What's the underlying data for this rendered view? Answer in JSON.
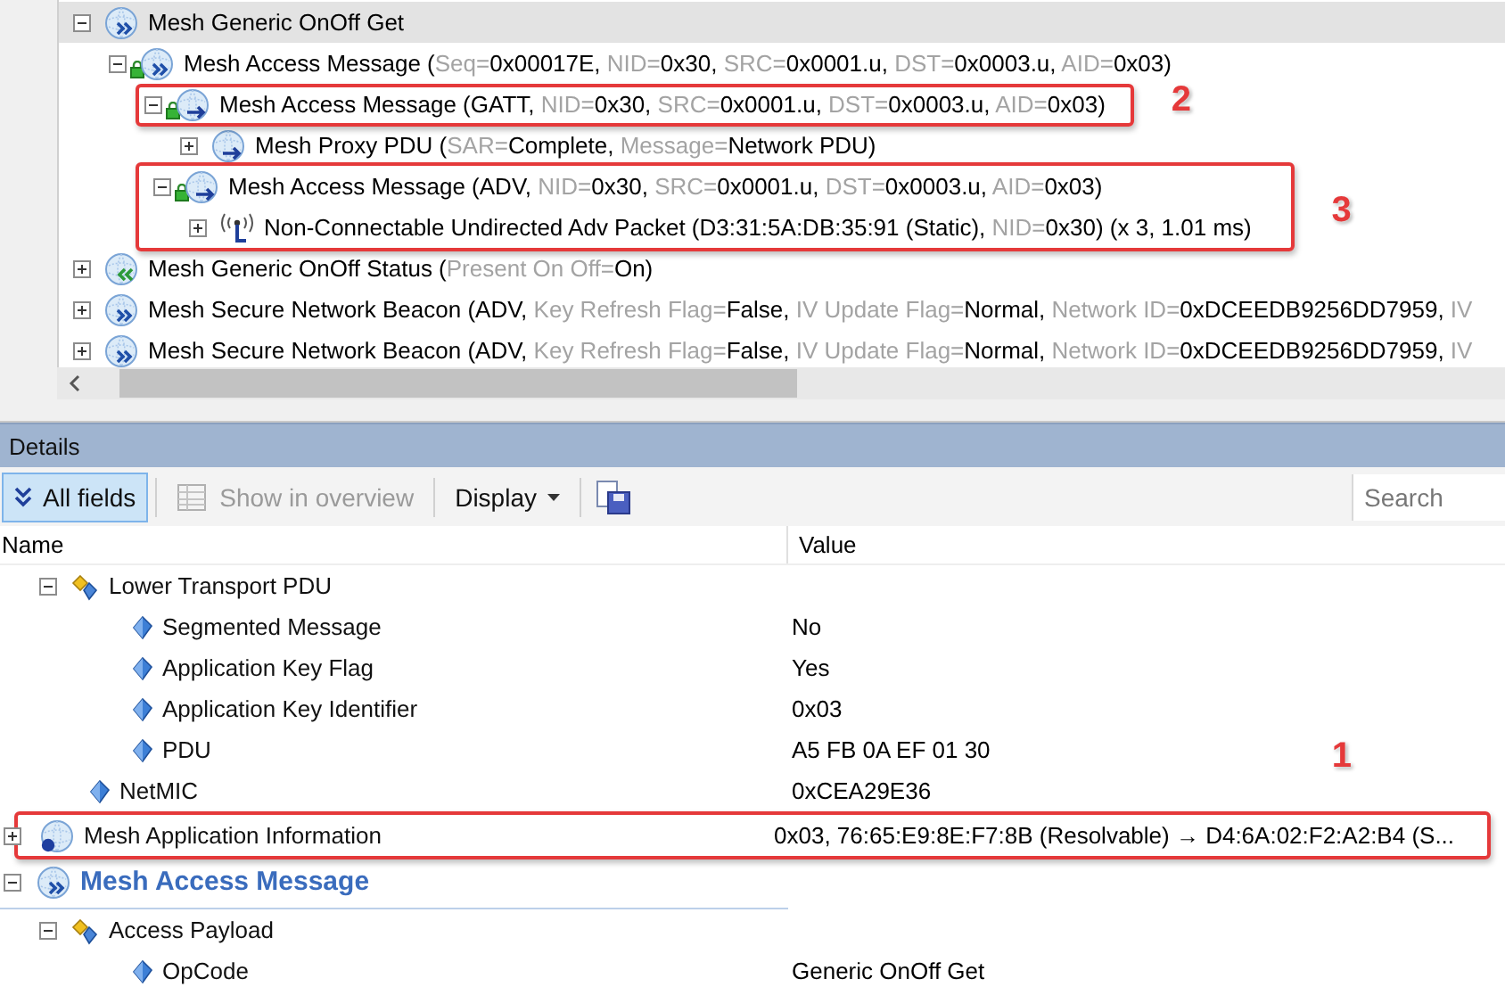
{
  "tree": [
    {
      "kind": "outbound",
      "locked": false,
      "expanded": true,
      "selected": true,
      "parts": [
        {
          "text": "Mesh Generic OnOff Get"
        }
      ],
      "children": [
        {
          "kind": "outbound",
          "locked": true,
          "expanded": true,
          "selected": false,
          "parts": [
            {
              "text": "Mesh Access Message ("
            },
            {
              "text": "Seq=",
              "muted": true
            },
            {
              "text": "0x00017E, "
            },
            {
              "text": "NID=",
              "muted": true
            },
            {
              "text": "0x30, "
            },
            {
              "text": "SRC=",
              "muted": true
            },
            {
              "text": "0x0001.u, "
            },
            {
              "text": "DST=",
              "muted": true
            },
            {
              "text": "0x0003.u, "
            },
            {
              "text": "AID=",
              "muted": true
            },
            {
              "text": "0x03)"
            }
          ],
          "children": [
            {
              "kind": "relay",
              "locked": true,
              "expanded": true,
              "selected": false,
              "callout": "2",
              "parts": [
                {
                  "text": "Mesh Access Message (GATT, "
                },
                {
                  "text": "NID=",
                  "muted": true
                },
                {
                  "text": "0x30, "
                },
                {
                  "text": "SRC=",
                  "muted": true
                },
                {
                  "text": "0x0001.u, "
                },
                {
                  "text": "DST=",
                  "muted": true
                },
                {
                  "text": "0x0003.u, "
                },
                {
                  "text": "AID=",
                  "muted": true
                },
                {
                  "text": "0x03)"
                }
              ],
              "children": [
                {
                  "kind": "relay",
                  "locked": false,
                  "expanded": false,
                  "selected": false,
                  "parts": [
                    {
                      "text": "Mesh Proxy PDU ("
                    },
                    {
                      "text": "SAR=",
                      "muted": true
                    },
                    {
                      "text": "Complete, "
                    },
                    {
                      "text": "Message=",
                      "muted": true
                    },
                    {
                      "text": "Network PDU)"
                    }
                  ]
                }
              ]
            },
            {
              "kind": "annotation",
              "callout": "3",
              "children": [
                {
                  "kind": "relay",
                  "locked": true,
                  "expanded": true,
                  "selected": false,
                  "parts": [
                    {
                      "text": "Mesh Access Message (ADV, "
                    },
                    {
                      "text": "NID=",
                      "muted": true
                    },
                    {
                      "text": "0x30, "
                    },
                    {
                      "text": "SRC=",
                      "muted": true
                    },
                    {
                      "text": "0x0001.u, "
                    },
                    {
                      "text": "DST=",
                      "muted": true
                    },
                    {
                      "text": "0x0003.u, "
                    },
                    {
                      "text": "AID=",
                      "muted": true
                    },
                    {
                      "text": "0x03)"
                    }
                  ],
                  "children": [
                    {
                      "kind": "radio",
                      "locked": false,
                      "expanded": false,
                      "selected": false,
                      "parts": [
                        {
                          "text": "Non-Connectable Undirected Adv Packet (D3:31:5A:DB:35:91 (Static), "
                        },
                        {
                          "text": "NID=",
                          "muted": true
                        },
                        {
                          "text": "0x30) (x 3, 1.01 ms)"
                        }
                      ]
                    }
                  ]
                }
              ]
            }
          ]
        }
      ]
    },
    {
      "kind": "inbound",
      "locked": false,
      "expanded": false,
      "selected": false,
      "parts": [
        {
          "text": "Mesh Generic OnOff Status ("
        },
        {
          "text": "Present On Off=",
          "muted": true
        },
        {
          "text": "On)"
        }
      ]
    },
    {
      "kind": "outbound",
      "locked": false,
      "expanded": false,
      "selected": false,
      "parts": [
        {
          "text": "Mesh Secure Network Beacon (ADV, "
        },
        {
          "text": "Key Refresh Flag=",
          "muted": true
        },
        {
          "text": "False, "
        },
        {
          "text": "IV Update Flag=",
          "muted": true
        },
        {
          "text": "Normal, "
        },
        {
          "text": "Network ID=",
          "muted": true
        },
        {
          "text": "0xDCEEDB9256DD7959, "
        },
        {
          "text": "IV",
          "muted": true
        }
      ]
    },
    {
      "kind": "outbound",
      "locked": false,
      "expanded": false,
      "selected": false,
      "parts": [
        {
          "text": "Mesh Secure Network Beacon (ADV, "
        },
        {
          "text": "Key Refresh Flag=",
          "muted": true
        },
        {
          "text": "False, "
        },
        {
          "text": "IV Update Flag=",
          "muted": true
        },
        {
          "text": "Normal, "
        },
        {
          "text": "Network ID=",
          "muted": true
        },
        {
          "text": "0xDCEEDB9256DD7959, "
        },
        {
          "text": "IV",
          "muted": true
        }
      ]
    }
  ],
  "details": {
    "title": "Details",
    "toolbar": [
      {
        "kind": "toggle",
        "label": "All fields",
        "pressed": true,
        "disabled": false
      },
      {
        "kind": "action",
        "label": "Show in overview",
        "pressed": false,
        "disabled": true
      },
      {
        "kind": "menu",
        "label": "Display",
        "pressed": false,
        "disabled": false
      },
      {
        "kind": "save",
        "pressed": false
      }
    ],
    "search": {
      "placeholder": "Search"
    },
    "columns": [
      "Name",
      "Value"
    ],
    "rows": [
      {
        "kind": "offscreen",
        "children": [
          {
            "kind": "group",
            "name": "Lower Transport PDU",
            "expanded": true,
            "children": [
              {
                "kind": "field",
                "name": "Segmented Message",
                "value": "No"
              },
              {
                "kind": "field",
                "name": "Application Key Flag",
                "value": "Yes"
              },
              {
                "kind": "field",
                "name": "Application Key Identifier",
                "value": "0x03"
              },
              {
                "kind": "field",
                "name": "PDU",
                "value": "A5 FB 0A EF 01 30"
              }
            ]
          },
          {
            "kind": "field",
            "name": "NetMIC",
            "value": "0xCEA29E36"
          }
        ]
      },
      {
        "kind": "info",
        "name": "Mesh Application Information",
        "value": "0x03, 76:65:E9:8E:F7:8B (Resolvable) → D4:6A:02:F2:A2:B4 (S...",
        "expanded": false,
        "callout": "1"
      },
      {
        "kind": "section",
        "name": "Mesh Access Message",
        "expanded": true,
        "children": [
          {
            "kind": "payload",
            "name": "Access Payload",
            "expanded": true,
            "children": [
              {
                "kind": "field",
                "name": "OpCode",
                "value": "Generic OnOff Get"
              }
            ]
          }
        ]
      }
    ]
  }
}
